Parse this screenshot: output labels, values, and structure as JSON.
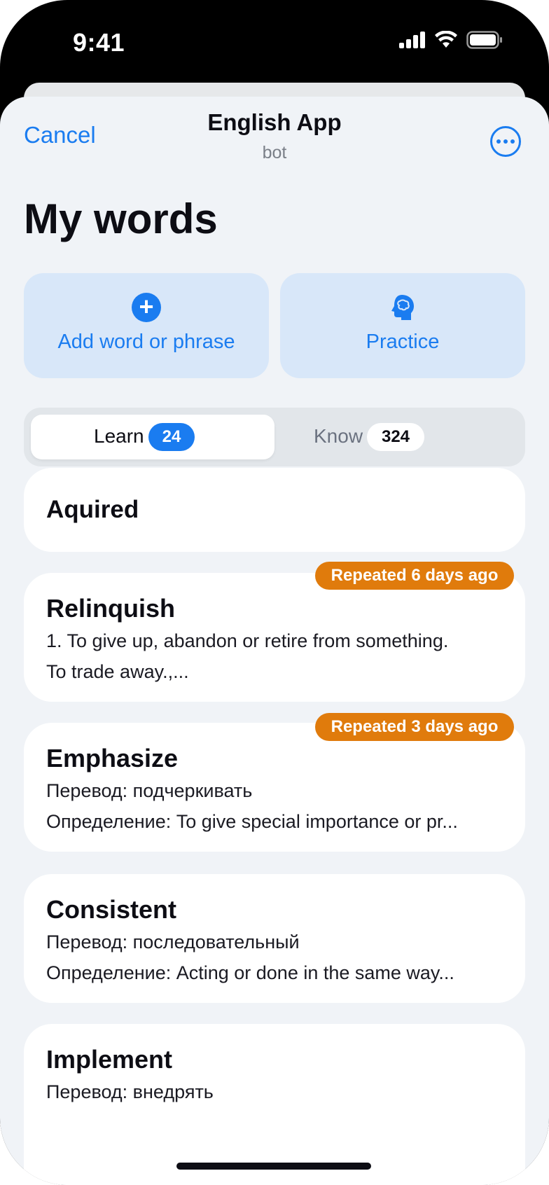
{
  "status": {
    "time": "9:41"
  },
  "nav": {
    "cancel": "Cancel",
    "title": "English App",
    "subtitle": "bot"
  },
  "page": {
    "title": "My words"
  },
  "actions": {
    "add_label": "Add word or phrase",
    "practice_label": "Practice"
  },
  "segments": {
    "learn": {
      "label": "Learn",
      "count": "24"
    },
    "know": {
      "label": "Know",
      "count": "324"
    }
  },
  "cards": [
    {
      "title": "Aquired"
    },
    {
      "tag": "Repeated 6 days ago",
      "title": "Relinquish",
      "line1": "1. To give up, abandon or retire from something.",
      "line2": "To trade away.,..."
    },
    {
      "tag": "Repeated 3 days ago",
      "title": "Emphasize",
      "line1": "Перевод: подчеркивать",
      "line2": "Определение: To give special importance or pr..."
    },
    {
      "title": "Consistent",
      "line1": "Перевод: последовательный",
      "line2": "Определение: Acting or done in the same way..."
    },
    {
      "title": "Implement",
      "line1": "Перевод: внедрять"
    }
  ],
  "colors": {
    "accent": "#1a7cf0",
    "tag": "#e07b0c",
    "background": "#f0f3f7"
  }
}
